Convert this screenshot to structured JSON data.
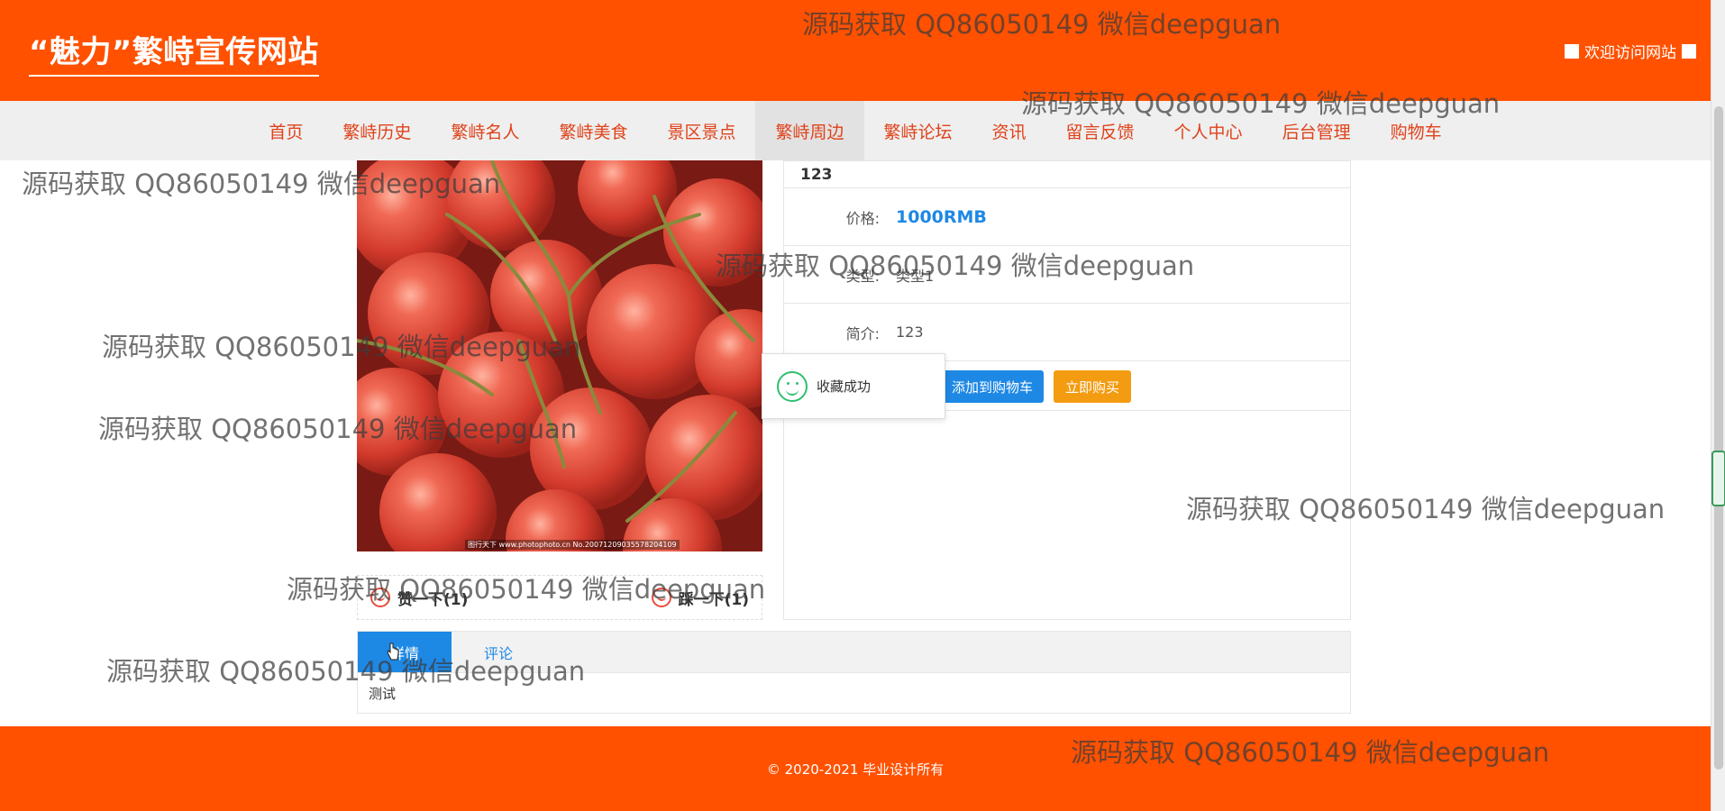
{
  "header": {
    "site_title": "“魅力”繁峙宣传网站",
    "welcome_text": "欢迎访问网站"
  },
  "nav": {
    "items": [
      {
        "label": "首页"
      },
      {
        "label": "繁峙历史"
      },
      {
        "label": "繁峙名人"
      },
      {
        "label": "繁峙美食"
      },
      {
        "label": "景区景点"
      },
      {
        "label": "繁峙周边"
      },
      {
        "label": "繁峙论坛"
      },
      {
        "label": "资讯"
      },
      {
        "label": "留言反馈"
      },
      {
        "label": "个人中心"
      },
      {
        "label": "后台管理"
      },
      {
        "label": "购物车"
      }
    ],
    "active_index": 5
  },
  "product": {
    "image_icon": "cherries-photo",
    "image_caption": "图行天下 www.photophoto.cn No.20071209035578204109",
    "name": "123",
    "price_label": "价格:",
    "price_value": "1000RMB",
    "type_label": "类型:",
    "type_value": "类型1",
    "intro_label": "简介:",
    "intro_value": "123",
    "add_to_cart": "添加到购物车",
    "buy_now": "立即购买"
  },
  "votes": {
    "like": "赞一下(1)",
    "dislike": "踩一下(1)"
  },
  "toast": {
    "text": "收藏成功",
    "icon": "smile-icon"
  },
  "tabs": {
    "items": [
      {
        "label": "详情"
      },
      {
        "label": "评论"
      }
    ],
    "active_index": 0,
    "content": "测试"
  },
  "footer": {
    "text": "© 2020-2021 毕业设计所有"
  },
  "watermark": {
    "text": "源码获取 QQ86050149 微信deepguan"
  },
  "colors": {
    "brand": "#ff5100",
    "accent_blue": "#1e88e5",
    "buy_orange": "#f39c12",
    "success_green": "#2fbf71"
  }
}
